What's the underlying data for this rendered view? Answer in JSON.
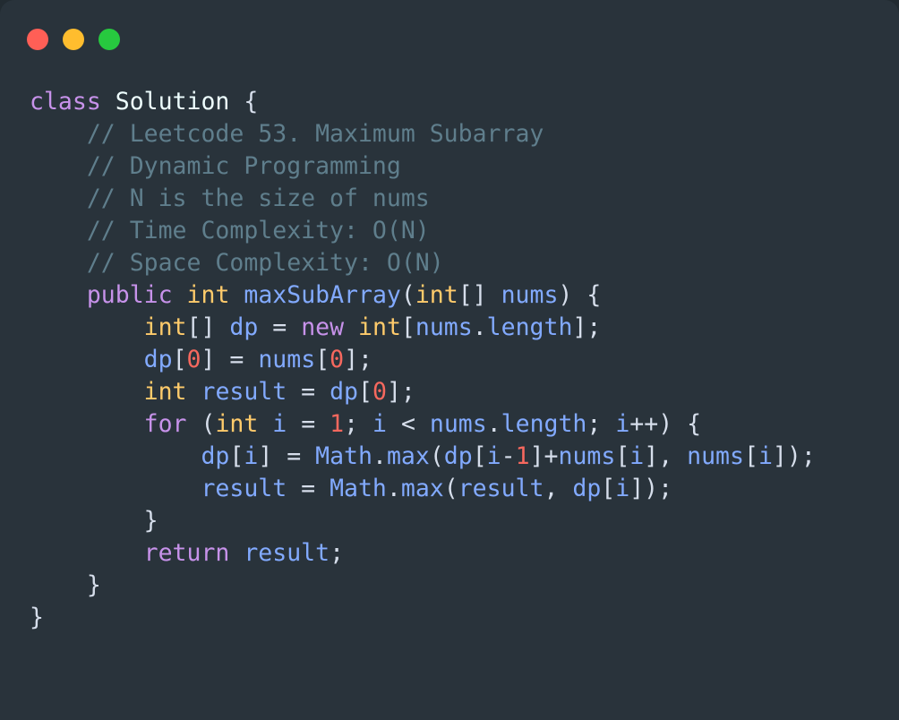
{
  "window": {
    "background_color": "#29333b",
    "corner_radius_px": 16,
    "traffic_lights": [
      {
        "name": "close-button",
        "color": "#ff5f56"
      },
      {
        "name": "minimize-button",
        "color": "#ffbd2e"
      },
      {
        "name": "maximize-button",
        "color": "#27c93f"
      }
    ]
  },
  "editor": {
    "language": "java",
    "theme_colors": {
      "keyword": "#c792ea",
      "type": "#ffcb6b",
      "identifier": "#82aaff",
      "number": "#f6685e",
      "class_name": "#eeffff",
      "punctuation": "#d6deeb",
      "comment": "#5f7e8c",
      "background": "#29333b"
    },
    "plain_text": "class Solution {\n    // Leetcode 53. Maximum Subarray\n    // Dynamic Programming\n    // N is the size of nums\n    // Time Complexity: O(N)\n    // Space Complexity: O(N)\n    public int maxSubArray(int[] nums) {\n        int[] dp = new int[nums.length];\n        dp[0] = nums[0];\n        int result = dp[0];\n        for (int i = 1; i < nums.length; i++) {\n            dp[i] = Math.max(dp[i-1]+nums[i], nums[i]);\n            result = Math.max(result, dp[i]);\n        }\n        return result;\n    }\n}",
    "lines": [
      [
        {
          "t": "class",
          "c": "kw"
        },
        {
          "t": " ",
          "c": "punct"
        },
        {
          "t": "Solution",
          "c": "cls"
        },
        {
          "t": " {",
          "c": "punct"
        }
      ],
      [
        {
          "t": "    ",
          "c": "punct"
        },
        {
          "t": "// Leetcode 53. Maximum Subarray",
          "c": "cmt"
        }
      ],
      [
        {
          "t": "    ",
          "c": "punct"
        },
        {
          "t": "// Dynamic Programming",
          "c": "cmt"
        }
      ],
      [
        {
          "t": "    ",
          "c": "punct"
        },
        {
          "t": "// N is the size of nums",
          "c": "cmt"
        }
      ],
      [
        {
          "t": "    ",
          "c": "punct"
        },
        {
          "t": "// Time Complexity: O(N)",
          "c": "cmt"
        }
      ],
      [
        {
          "t": "    ",
          "c": "punct"
        },
        {
          "t": "// Space Complexity: O(N)",
          "c": "cmt"
        }
      ],
      [
        {
          "t": "    ",
          "c": "punct"
        },
        {
          "t": "public",
          "c": "kw"
        },
        {
          "t": " ",
          "c": "punct"
        },
        {
          "t": "int",
          "c": "typ"
        },
        {
          "t": " ",
          "c": "punct"
        },
        {
          "t": "maxSubArray",
          "c": "id"
        },
        {
          "t": "(",
          "c": "punct"
        },
        {
          "t": "int",
          "c": "typ"
        },
        {
          "t": "[] ",
          "c": "punct"
        },
        {
          "t": "nums",
          "c": "id"
        },
        {
          "t": ") {",
          "c": "punct"
        }
      ],
      [
        {
          "t": "        ",
          "c": "punct"
        },
        {
          "t": "int",
          "c": "typ"
        },
        {
          "t": "[] ",
          "c": "punct"
        },
        {
          "t": "dp",
          "c": "id"
        },
        {
          "t": " = ",
          "c": "punct"
        },
        {
          "t": "new",
          "c": "kw"
        },
        {
          "t": " ",
          "c": "punct"
        },
        {
          "t": "int",
          "c": "typ"
        },
        {
          "t": "[",
          "c": "punct"
        },
        {
          "t": "nums",
          "c": "id"
        },
        {
          "t": ".",
          "c": "punct"
        },
        {
          "t": "length",
          "c": "id"
        },
        {
          "t": "];",
          "c": "punct"
        }
      ],
      [
        {
          "t": "        ",
          "c": "punct"
        },
        {
          "t": "dp",
          "c": "id"
        },
        {
          "t": "[",
          "c": "punct"
        },
        {
          "t": "0",
          "c": "num"
        },
        {
          "t": "] = ",
          "c": "punct"
        },
        {
          "t": "nums",
          "c": "id"
        },
        {
          "t": "[",
          "c": "punct"
        },
        {
          "t": "0",
          "c": "num"
        },
        {
          "t": "];",
          "c": "punct"
        }
      ],
      [
        {
          "t": "        ",
          "c": "punct"
        },
        {
          "t": "int",
          "c": "typ"
        },
        {
          "t": " ",
          "c": "punct"
        },
        {
          "t": "result",
          "c": "id"
        },
        {
          "t": " = ",
          "c": "punct"
        },
        {
          "t": "dp",
          "c": "id"
        },
        {
          "t": "[",
          "c": "punct"
        },
        {
          "t": "0",
          "c": "num"
        },
        {
          "t": "];",
          "c": "punct"
        }
      ],
      [
        {
          "t": "        ",
          "c": "punct"
        },
        {
          "t": "for",
          "c": "kw"
        },
        {
          "t": " (",
          "c": "punct"
        },
        {
          "t": "int",
          "c": "typ"
        },
        {
          "t": " ",
          "c": "punct"
        },
        {
          "t": "i",
          "c": "id"
        },
        {
          "t": " = ",
          "c": "punct"
        },
        {
          "t": "1",
          "c": "num"
        },
        {
          "t": "; ",
          "c": "punct"
        },
        {
          "t": "i",
          "c": "id"
        },
        {
          "t": " < ",
          "c": "punct"
        },
        {
          "t": "nums",
          "c": "id"
        },
        {
          "t": ".",
          "c": "punct"
        },
        {
          "t": "length",
          "c": "id"
        },
        {
          "t": "; ",
          "c": "punct"
        },
        {
          "t": "i",
          "c": "id"
        },
        {
          "t": "++) {",
          "c": "punct"
        }
      ],
      [
        {
          "t": "            ",
          "c": "punct"
        },
        {
          "t": "dp",
          "c": "id"
        },
        {
          "t": "[",
          "c": "punct"
        },
        {
          "t": "i",
          "c": "id"
        },
        {
          "t": "] = ",
          "c": "punct"
        },
        {
          "t": "Math",
          "c": "id"
        },
        {
          "t": ".",
          "c": "punct"
        },
        {
          "t": "max",
          "c": "id"
        },
        {
          "t": "(",
          "c": "punct"
        },
        {
          "t": "dp",
          "c": "id"
        },
        {
          "t": "[",
          "c": "punct"
        },
        {
          "t": "i",
          "c": "id"
        },
        {
          "t": "-",
          "c": "punct"
        },
        {
          "t": "1",
          "c": "num"
        },
        {
          "t": "]+",
          "c": "punct"
        },
        {
          "t": "nums",
          "c": "id"
        },
        {
          "t": "[",
          "c": "punct"
        },
        {
          "t": "i",
          "c": "id"
        },
        {
          "t": "], ",
          "c": "punct"
        },
        {
          "t": "nums",
          "c": "id"
        },
        {
          "t": "[",
          "c": "punct"
        },
        {
          "t": "i",
          "c": "id"
        },
        {
          "t": "]);",
          "c": "punct"
        }
      ],
      [
        {
          "t": "            ",
          "c": "punct"
        },
        {
          "t": "result",
          "c": "id"
        },
        {
          "t": " = ",
          "c": "punct"
        },
        {
          "t": "Math",
          "c": "id"
        },
        {
          "t": ".",
          "c": "punct"
        },
        {
          "t": "max",
          "c": "id"
        },
        {
          "t": "(",
          "c": "punct"
        },
        {
          "t": "result",
          "c": "id"
        },
        {
          "t": ", ",
          "c": "punct"
        },
        {
          "t": "dp",
          "c": "id"
        },
        {
          "t": "[",
          "c": "punct"
        },
        {
          "t": "i",
          "c": "id"
        },
        {
          "t": "]);",
          "c": "punct"
        }
      ],
      [
        {
          "t": "        }",
          "c": "punct"
        }
      ],
      [
        {
          "t": "        ",
          "c": "punct"
        },
        {
          "t": "return",
          "c": "kw"
        },
        {
          "t": " ",
          "c": "punct"
        },
        {
          "t": "result",
          "c": "id"
        },
        {
          "t": ";",
          "c": "punct"
        }
      ],
      [
        {
          "t": "    }",
          "c": "punct"
        }
      ],
      [
        {
          "t": "}",
          "c": "punct"
        }
      ]
    ]
  }
}
